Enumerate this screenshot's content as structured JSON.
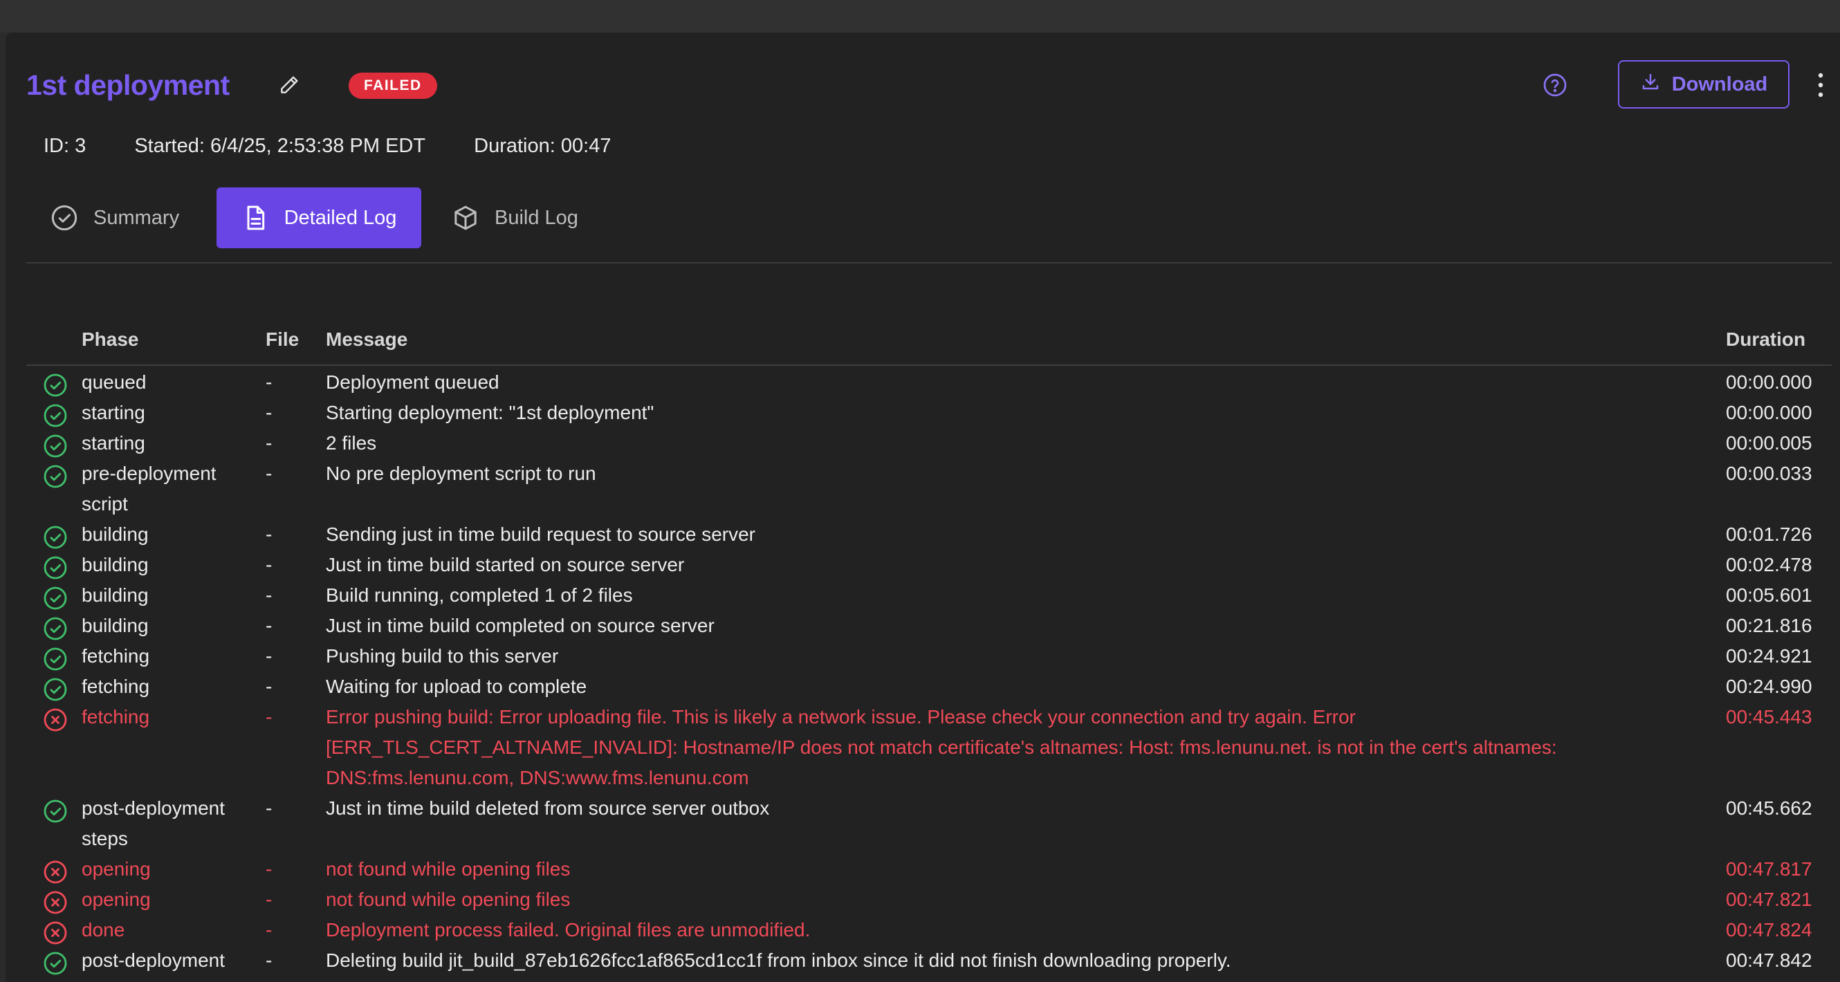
{
  "header": {
    "title": "1st deployment",
    "status_badge": "FAILED",
    "download_label": "Download"
  },
  "meta": {
    "id_label": "ID:",
    "id_value": "3",
    "started_label": "Started:",
    "started_value": "6/4/25, 2:53:38 PM EDT",
    "duration_label": "Duration:",
    "duration_value": "00:47"
  },
  "tabs": [
    {
      "label": "Summary",
      "icon": "check-circle-icon",
      "active": false
    },
    {
      "label": "Detailed Log",
      "icon": "document-icon",
      "active": true
    },
    {
      "label": "Build Log",
      "icon": "box-icon",
      "active": false
    }
  ],
  "table": {
    "columns": {
      "phase": "Phase",
      "file": "File",
      "message": "Message",
      "duration": "Duration"
    },
    "rows": [
      {
        "status": "ok",
        "phase": "queued",
        "file": "-",
        "message": "Deployment queued",
        "duration": "00:00.000"
      },
      {
        "status": "ok",
        "phase": "starting",
        "file": "-",
        "message": "Starting  deployment: \"1st deployment\"",
        "duration": "00:00.000"
      },
      {
        "status": "ok",
        "phase": "starting",
        "file": "-",
        "message": "2 files",
        "duration": "00:00.005"
      },
      {
        "status": "ok",
        "phase": "pre-deployment script",
        "file": "-",
        "message": "No pre deployment script to run",
        "duration": "00:00.033"
      },
      {
        "status": "ok",
        "phase": "building",
        "file": "-",
        "message": "Sending just in time build request to source server",
        "duration": "00:01.726"
      },
      {
        "status": "ok",
        "phase": "building",
        "file": "-",
        "message": "Just in time build started on source server",
        "duration": "00:02.478"
      },
      {
        "status": "ok",
        "phase": "building",
        "file": "-",
        "message": "Build running, completed 1 of 2 files",
        "duration": "00:05.601"
      },
      {
        "status": "ok",
        "phase": "building",
        "file": "-",
        "message": "Just in time build completed on source server",
        "duration": "00:21.816"
      },
      {
        "status": "ok",
        "phase": "fetching",
        "file": "-",
        "message": "Pushing build to this server",
        "duration": "00:24.921"
      },
      {
        "status": "ok",
        "phase": "fetching",
        "file": "-",
        "message": "Waiting for upload to complete",
        "duration": "00:24.990"
      },
      {
        "status": "error",
        "phase": "fetching",
        "file": "-",
        "message": "Error pushing build: Error uploading file. This is likely a network issue. Please check your connection and try again. Error [ERR_TLS_CERT_ALTNAME_INVALID]: Hostname/IP does not match certificate's altnames: Host: fms.lenunu.net. is not in the cert's altnames: DNS:fms.lenunu.com, DNS:www.fms.lenunu.com",
        "duration": "00:45.443"
      },
      {
        "status": "ok",
        "phase": "post-deployment steps",
        "file": "-",
        "message": "Just in time build deleted from source server outbox",
        "duration": "00:45.662"
      },
      {
        "status": "error",
        "phase": "opening",
        "file": "-",
        "message": "not found while opening files",
        "duration": "00:47.817"
      },
      {
        "status": "error",
        "phase": "opening",
        "file": "-",
        "message": "not found while opening files",
        "duration": "00:47.821"
      },
      {
        "status": "error",
        "phase": "done",
        "file": "-",
        "message": "Deployment process failed. Original files are unmodified.",
        "duration": "00:47.824"
      },
      {
        "status": "ok",
        "phase": "post-deployment steps",
        "file": "-",
        "message": "Deleting build jit_build_87eb1626fcc1af865cd1cc1f from inbox since it did not finish downloading properly.",
        "duration": "00:47.842"
      }
    ]
  },
  "colors": {
    "accent": "#7b5cf0",
    "tab_active": "#6a45e6",
    "error": "#ef4a57",
    "success": "#3fbf6a",
    "badge": "#e02d3c"
  }
}
